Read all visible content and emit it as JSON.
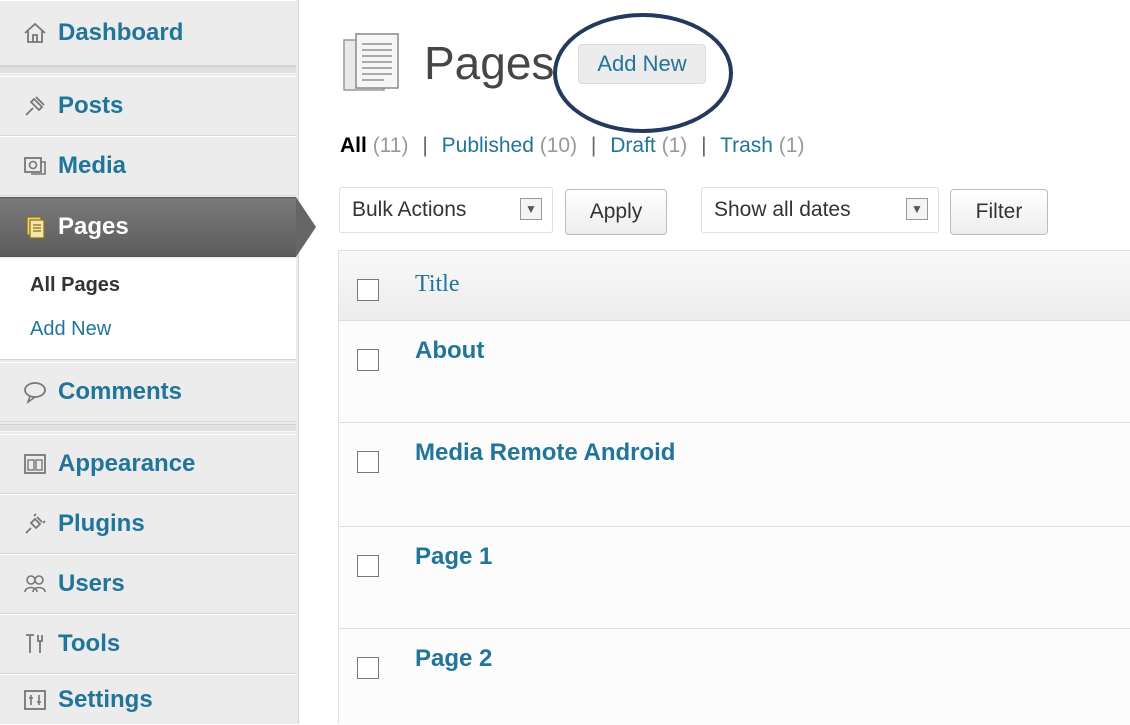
{
  "sidebar": {
    "items": [
      {
        "label": "Dashboard",
        "icon": "home-icon"
      },
      {
        "label": "Posts",
        "icon": "pin-icon"
      },
      {
        "label": "Media",
        "icon": "media-icon"
      },
      {
        "label": "Pages",
        "icon": "pages-icon"
      },
      {
        "label": "Comments",
        "icon": "comment-icon"
      },
      {
        "label": "Appearance",
        "icon": "appearance-icon"
      },
      {
        "label": "Plugins",
        "icon": "plug-icon"
      },
      {
        "label": "Users",
        "icon": "users-icon"
      },
      {
        "label": "Tools",
        "icon": "tools-icon"
      },
      {
        "label": "Settings",
        "icon": "settings-icon"
      }
    ],
    "submenu": {
      "current": "All Pages",
      "add_new": "Add New"
    }
  },
  "header": {
    "title": "Pages",
    "add_new": "Add New"
  },
  "filters": {
    "all": {
      "label": "All",
      "count": "(11)"
    },
    "published": {
      "label": "Published",
      "count": "(10)"
    },
    "draft": {
      "label": "Draft",
      "count": "(1)"
    },
    "trash": {
      "label": "Trash",
      "count": "(1)"
    },
    "separator": "|"
  },
  "toolbar": {
    "bulk_actions": "Bulk Actions",
    "apply": "Apply",
    "dates": "Show all dates",
    "filter": "Filter"
  },
  "table": {
    "column_title": "Title",
    "rows": [
      "About",
      "Media Remote Android",
      "Page 1",
      "Page 2"
    ]
  },
  "colors": {
    "link": "#21759b",
    "highlight_ring": "#233a5e",
    "current_menu": "#666666"
  }
}
